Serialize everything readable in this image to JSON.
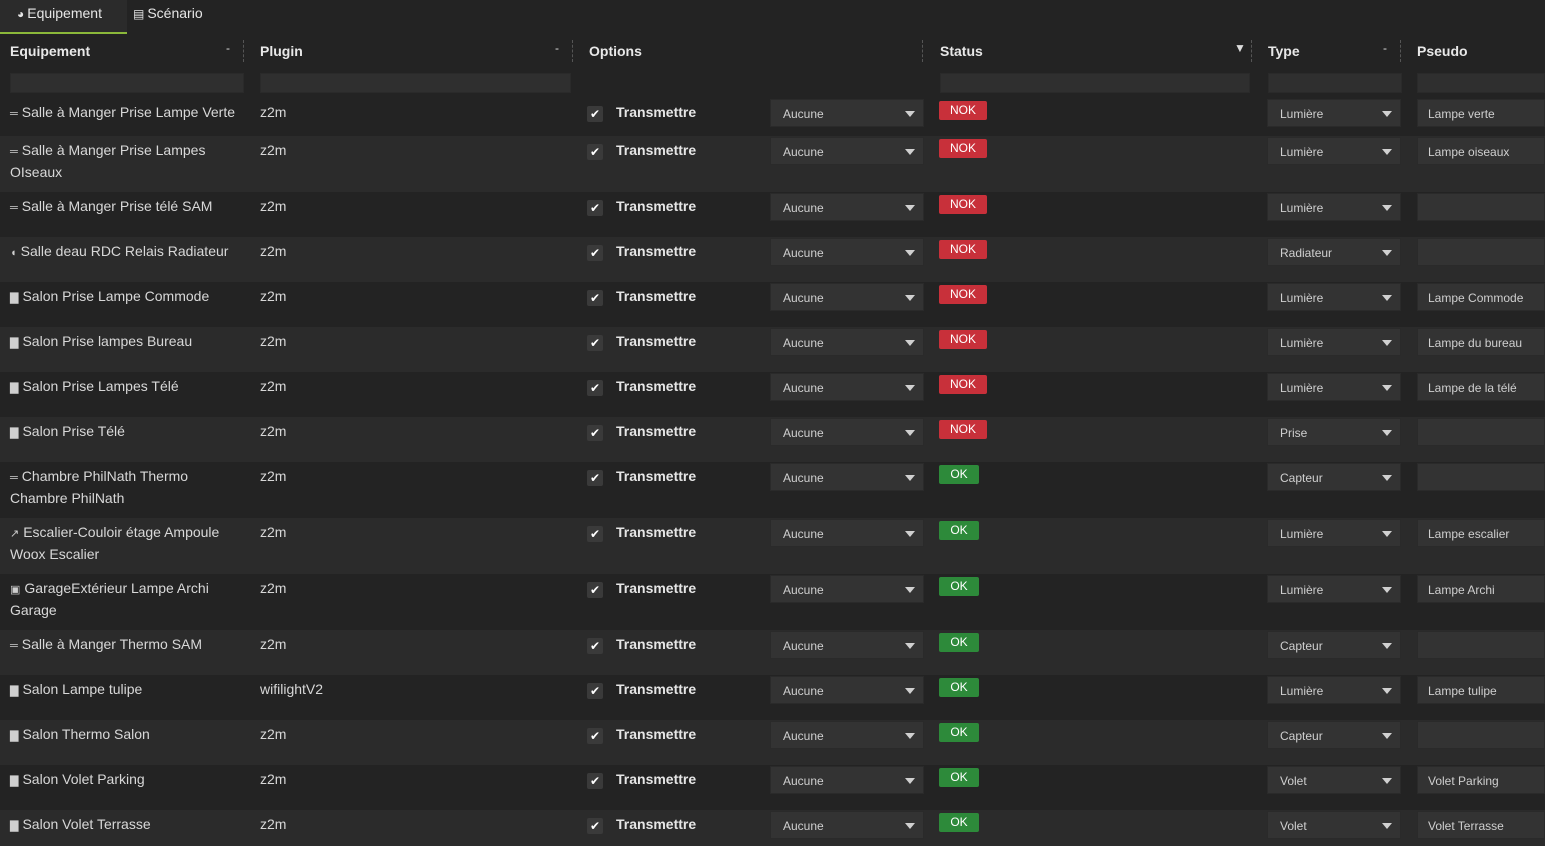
{
  "tabs": [
    {
      "label": "Equipement",
      "icon": "tachometer-icon"
    },
    {
      "label": "Scénario",
      "icon": "list-icon"
    }
  ],
  "columns": {
    "equipement": "Equipement",
    "plugin": "Plugin",
    "options": "Options",
    "status": "Status",
    "type": "Type",
    "pseudo": "Pseudo"
  },
  "checkbox_label": "Transmettre",
  "rows": [
    {
      "name": "Salle à Manger Prise Lampe Verte",
      "icon": "bed-icon",
      "plugin": "z2m",
      "option": "Aucune",
      "status": "NOK",
      "type": "Lumière",
      "pseudo": "Lampe verte"
    },
    {
      "name": "Salle à Manger Prise Lampes OIseaux",
      "icon": "bed-icon",
      "plugin": "z2m",
      "option": "Aucune",
      "status": "NOK",
      "type": "Lumière",
      "pseudo": "Lampe oiseaux"
    },
    {
      "name": "Salle à Manger Prise télé SAM",
      "icon": "bed-icon",
      "plugin": "z2m",
      "option": "Aucune",
      "status": "NOK",
      "type": "Lumière",
      "pseudo": ""
    },
    {
      "name": "Salle deau RDC Relais Radiateur",
      "icon": "shower-icon",
      "plugin": "z2m",
      "option": "Aucune",
      "status": "NOK",
      "type": "Radiateur",
      "pseudo": ""
    },
    {
      "name": "Salon Prise Lampe Commode",
      "icon": "sofa-icon",
      "plugin": "z2m",
      "option": "Aucune",
      "status": "NOK",
      "type": "Lumière",
      "pseudo": "Lampe Commode"
    },
    {
      "name": "Salon Prise lampes Bureau",
      "icon": "sofa-icon",
      "plugin": "z2m",
      "option": "Aucune",
      "status": "NOK",
      "type": "Lumière",
      "pseudo": "Lampe du bureau"
    },
    {
      "name": "Salon Prise Lampes Télé",
      "icon": "sofa-icon",
      "plugin": "z2m",
      "option": "Aucune",
      "status": "NOK",
      "type": "Lumière",
      "pseudo": "Lampe de la télé"
    },
    {
      "name": "Salon Prise Télé",
      "icon": "sofa-icon",
      "plugin": "z2m",
      "option": "Aucune",
      "status": "NOK",
      "type": "Prise",
      "pseudo": ""
    },
    {
      "name": "Chambre PhilNath Thermo Chambre PhilNath",
      "icon": "bed-icon",
      "plugin": "z2m",
      "option": "Aucune",
      "status": "OK",
      "type": "Capteur",
      "pseudo": ""
    },
    {
      "name": "Escalier-Couloir étage Ampoule Woox Escalier",
      "icon": "stairs-icon",
      "plugin": "z2m",
      "option": "Aucune",
      "status": "OK",
      "type": "Lumière",
      "pseudo": "Lampe escalier"
    },
    {
      "name": "GarageExtérieur Lampe Archi Garage",
      "icon": "car-icon",
      "plugin": "z2m",
      "option": "Aucune",
      "status": "OK",
      "type": "Lumière",
      "pseudo": "Lampe Archi"
    },
    {
      "name": "Salle à Manger Thermo SAM",
      "icon": "bed-icon",
      "plugin": "z2m",
      "option": "Aucune",
      "status": "OK",
      "type": "Capteur",
      "pseudo": ""
    },
    {
      "name": "Salon Lampe tulipe",
      "icon": "sofa-icon",
      "plugin": "wifilightV2",
      "option": "Aucune",
      "status": "OK",
      "type": "Lumière",
      "pseudo": "Lampe tulipe"
    },
    {
      "name": "Salon Thermo Salon",
      "icon": "sofa-icon",
      "plugin": "z2m",
      "option": "Aucune",
      "status": "OK",
      "type": "Capteur",
      "pseudo": ""
    },
    {
      "name": "Salon Volet Parking",
      "icon": "sofa-icon",
      "plugin": "z2m",
      "option": "Aucune",
      "status": "OK",
      "type": "Volet",
      "pseudo": "Volet Parking"
    },
    {
      "name": "Salon Volet Terrasse",
      "icon": "sofa-icon",
      "plugin": "z2m",
      "option": "Aucune",
      "status": "OK",
      "type": "Volet",
      "pseudo": "Volet Terrasse"
    }
  ]
}
